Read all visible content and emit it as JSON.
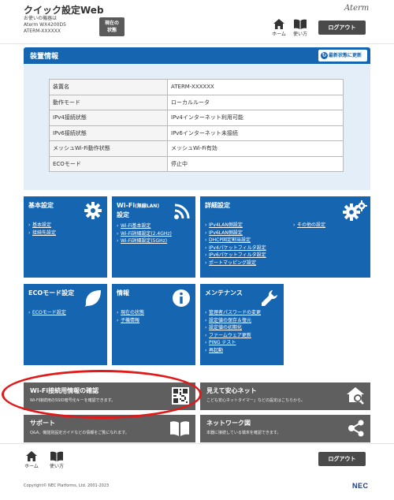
{
  "header": {
    "title": "クイック設定Web",
    "device_label": "お使いの機器は",
    "model": "Aterm WX4200D5",
    "hostname": "ATERM-XXXXXX",
    "status_button": "現在の\n状態",
    "logo": "Aterm",
    "home_label": "ホーム",
    "help_label": "使い方",
    "logout_label": "ログアウト"
  },
  "device_info": {
    "heading": "装置情報",
    "refresh_label": "最新状態に更新",
    "rows": [
      {
        "key": "装置名",
        "value": "ATERM-XXXXXX"
      },
      {
        "key": "動作モード",
        "value": "ローカルルータ"
      },
      {
        "key": "IPv4接続状態",
        "value": "IPv4インターネット利用可能"
      },
      {
        "key": "IPv6接続状態",
        "value": "IPv6インターネット未接続"
      },
      {
        "key": "メッシュWi-Fi動作状態",
        "value": "メッシュWi-Fi有効"
      },
      {
        "key": "ECOモード",
        "value": "停止中"
      }
    ]
  },
  "tiles": {
    "basic": {
      "title": "基本設定",
      "links": [
        "基本設定",
        "接続先設定"
      ]
    },
    "wifi": {
      "title_main": "Wi-Fi",
      "title_small": "(無線LAN)",
      "title_line2": "設定",
      "links": [
        "Wi-Fi基本設定",
        "Wi-Fi詳細設定(2.4GHz)",
        "Wi-Fi詳細設定(5GHz)"
      ]
    },
    "advanced": {
      "title": "詳細設定",
      "links": [
        "IPv4LAN側設定",
        "IPv6LAN側設定",
        "DHCP固定割当設定",
        "IPv4パケットフィルタ設定",
        "IPv6パケットフィルタ設定",
        "ポートマッピング設定"
      ],
      "links2": [
        "その他の設定"
      ]
    },
    "eco": {
      "title": "ECOモード設定",
      "links": [
        "ECOモード設定"
      ]
    },
    "info": {
      "title": "情報",
      "links": [
        "現在の状態",
        "子機情報"
      ]
    },
    "maintenance": {
      "title": "メンテナンス",
      "links": [
        "管理者パスワードの変更",
        "設定値の保存＆復元",
        "設定値の初期化",
        "ファームウェア更新",
        "PING テスト",
        "再起動"
      ]
    }
  },
  "bars": {
    "wifi_check": {
      "title": "Wi-Fi接続用情報の確認",
      "desc": "Wi-Fi接続用のSSID暗号化キーを確認できます。"
    },
    "kids_net": {
      "title": "見えて安心ネット",
      "desc": "こども安心ネットタイマー」などの設定はこちらから。"
    },
    "support": {
      "title": "サポート",
      "desc": "Q&A、機能別設定ガイドなどの情報をご覧になれます。"
    },
    "network_map": {
      "title": "ネットワーク図",
      "desc": "本器に接続している端末を確認できます。"
    }
  },
  "footer": {
    "home_label": "ホーム",
    "help_label": "使い方",
    "logout_label": "ログアウト",
    "copyright": "Copyright© NEC Platforms, Ltd. 2001-2023",
    "brand": "NEC"
  },
  "colors": {
    "accent_blue": "#1565b0",
    "dark_gray": "#5f5f5f",
    "highlight_red": "#e01a1a"
  }
}
